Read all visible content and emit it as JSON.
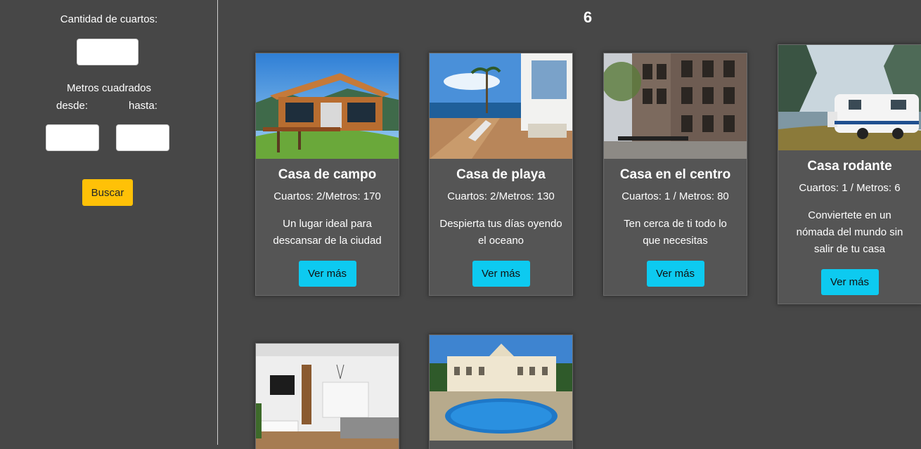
{
  "sidebar": {
    "rooms_label": "Cantidad de cuartos:",
    "rooms_value": "",
    "meters_label": "Metros cuadrados",
    "from_label": "desde:",
    "to_label": "hasta:",
    "from_value": "",
    "to_value": "",
    "search_button": "Buscar"
  },
  "results_count": "6",
  "cards": [
    {
      "title": "Casa de campo",
      "meta": "Cuartos: 2/Metros: 170",
      "desc": "Un lugar ideal para descansar de la ciudad",
      "button": "Ver más"
    },
    {
      "title": "Casa de playa",
      "meta": "Cuartos: 2/Metros: 130",
      "desc": "Despierta tus días oyendo el oceano",
      "button": "Ver más"
    },
    {
      "title": "Casa en el centro",
      "meta": "Cuartos: 1 / Metros: 80",
      "desc": "Ten cerca de ti todo lo que necesitas",
      "button": "Ver más"
    },
    {
      "title": "Casa rodante",
      "meta": "Cuartos: 1  /  Metros: 6",
      "desc": "Conviertete en un nómada del mundo sin salir de tu casa",
      "button": "Ver más"
    }
  ]
}
